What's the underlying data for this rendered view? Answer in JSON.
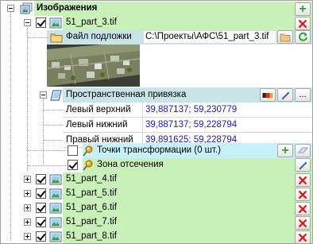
{
  "tree": {
    "root_label": "Изображения",
    "image1": {
      "file_name": "51_part_3.tif",
      "background_file_label": "Файл подложки",
      "background_file_path": "C:\\Проекты\\АФС\\51_part_3.tif",
      "georef": {
        "label": "Пространственная привязка",
        "more_label": "...",
        "corners": [
          {
            "label": "Левый верхний",
            "value": "39,887137; 59,230779"
          },
          {
            "label": "Левый нижний",
            "value": "39,887137; 59,228794"
          },
          {
            "label": "Правый нижний",
            "value": "39,891625; 59,228794"
          }
        ]
      },
      "transform_points_label": "Точки трансформации (0 шт.)",
      "clip_zone_label": "Зона отсечения"
    },
    "other_images": [
      {
        "file_name": "51_part_4.tif"
      },
      {
        "file_name": "51_part_5.tif"
      },
      {
        "file_name": "51_part_6.tif"
      },
      {
        "file_name": "51_part_7.tif"
      },
      {
        "file_name": "51_part_8.tif"
      }
    ]
  },
  "colors": {
    "row_green": "#c8f0b8",
    "row_teal": "#c8e4e8",
    "row_cyan": "#c8f0f8",
    "coord_text": "#1c1cb4",
    "delete_red": "#e01010",
    "add_green": "#30a030"
  },
  "icons": {
    "expand": "minus-box",
    "image": "picture-icon",
    "folder": "folder-icon",
    "georef": "parallelogram-icon",
    "pin": "pushpin-icon",
    "add": "green-plus-icon",
    "delete": "red-x-icon",
    "refresh": "green-refresh-icon",
    "edit": "pencil-icon",
    "ruler": "ruler-icon",
    "eraser": "eraser-icon"
  }
}
